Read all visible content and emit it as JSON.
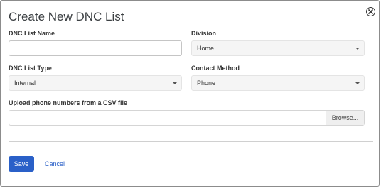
{
  "dialog": {
    "title": "Create New DNC List"
  },
  "form": {
    "dnc_list_name": {
      "label": "DNC List Name",
      "value": "",
      "placeholder": ""
    },
    "division": {
      "label": "Division",
      "selected": "Home"
    },
    "dnc_list_type": {
      "label": "DNC List Type",
      "selected": "Internal"
    },
    "contact_method": {
      "label": "Contact Method",
      "selected": "Phone"
    },
    "upload": {
      "label": "Upload phone numbers from a CSV file",
      "value": "",
      "browse_label": "Browse..."
    }
  },
  "actions": {
    "save_label": "Save",
    "cancel_label": "Cancel"
  },
  "icons": {
    "close": "close-icon",
    "dropdown": "chevron-down-icon"
  },
  "colors": {
    "primary": "#2a60c8",
    "title_text": "#3c4043",
    "select_bg": "#f5f5f5"
  }
}
